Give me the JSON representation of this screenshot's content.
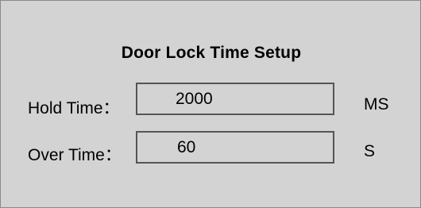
{
  "dialog": {
    "title": "Door Lock Time Setup",
    "hold_time": {
      "label": "Hold Time：",
      "value": "2000",
      "unit": "MS"
    },
    "over_time": {
      "label": "Over Time：",
      "value": "60",
      "unit": "S"
    }
  }
}
